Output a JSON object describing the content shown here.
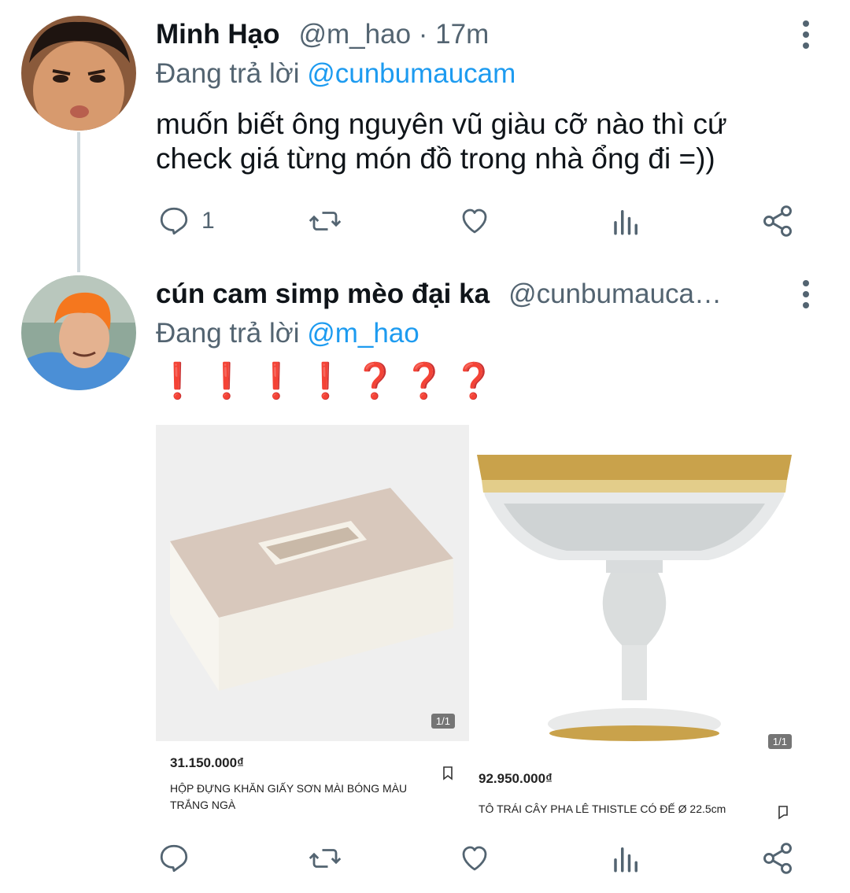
{
  "tweets": [
    {
      "name": "Minh Hạo",
      "handle": "@m_hao · 17m",
      "reply_label": "Đang trả lời",
      "reply_mention": "@cunbumaucam",
      "text": "muốn biết ông nguyên vũ giàu cỡ nào thì cứ check giá từng món đồ trong nhà ổng đi =))",
      "reply_count": "1"
    },
    {
      "name": "cún cam simp mèo đại ka",
      "handle": "@cunbumauca…",
      "reply_label": "Đang trả lời",
      "reply_mention": "@m_hao",
      "text": "❗❗❗❗❓❓❓",
      "reply_count": ""
    }
  ],
  "products": [
    {
      "price": "31.150.000₫",
      "name": "HỘP ĐỰNG KHĂN GIẤY SƠN MÀI BÓNG MÀU TRẮNG NGÀ",
      "pager": "1/1"
    },
    {
      "price": "92.950.000₫",
      "name": "TÔ TRÁI CÂY PHA LÊ THISTLE CÓ ĐẾ Ø 22.5cm",
      "pager": "1/1"
    }
  ],
  "colors": {
    "accent": "#1d9bf0",
    "secondary_text": "#536471",
    "emoji_red": "#e0212b"
  }
}
